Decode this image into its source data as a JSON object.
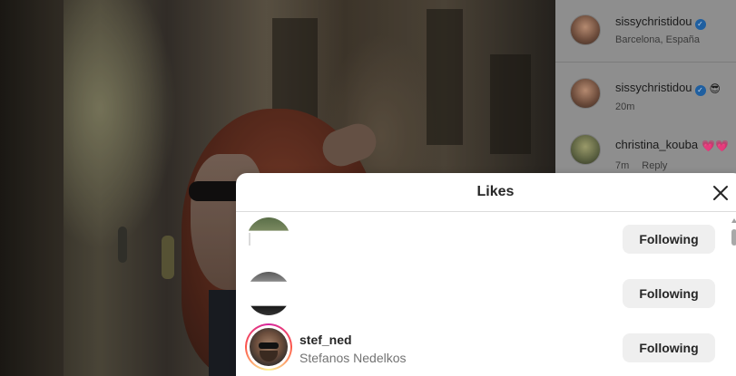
{
  "post": {
    "image_label": "post-photo"
  },
  "comments_panel": {
    "header": {
      "username": "sissychristidou",
      "location": "Barcelona, España"
    },
    "comments": [
      {
        "username": "sissychristidou",
        "emoji": "😎",
        "time": "20m",
        "reply": ""
      },
      {
        "username": "christina_kouba",
        "emoji": "💗💗",
        "time": "7m",
        "reply": "Reply"
      }
    ]
  },
  "likes_modal": {
    "title": "Likes",
    "close_icon": "close-icon",
    "rows": [
      {
        "username": "",
        "full_name": "",
        "button": "Following"
      },
      {
        "username": "",
        "full_name": "",
        "button": "Following"
      },
      {
        "username": "stef_ned",
        "full_name": "Stefanos Nedelkos",
        "button": "Following"
      }
    ]
  },
  "colors": {
    "button_bg": "#efefef",
    "verified": "#0095f6",
    "modal_bg": "#ffffff",
    "overlay": "rgba(0,0,0,0.65)"
  }
}
